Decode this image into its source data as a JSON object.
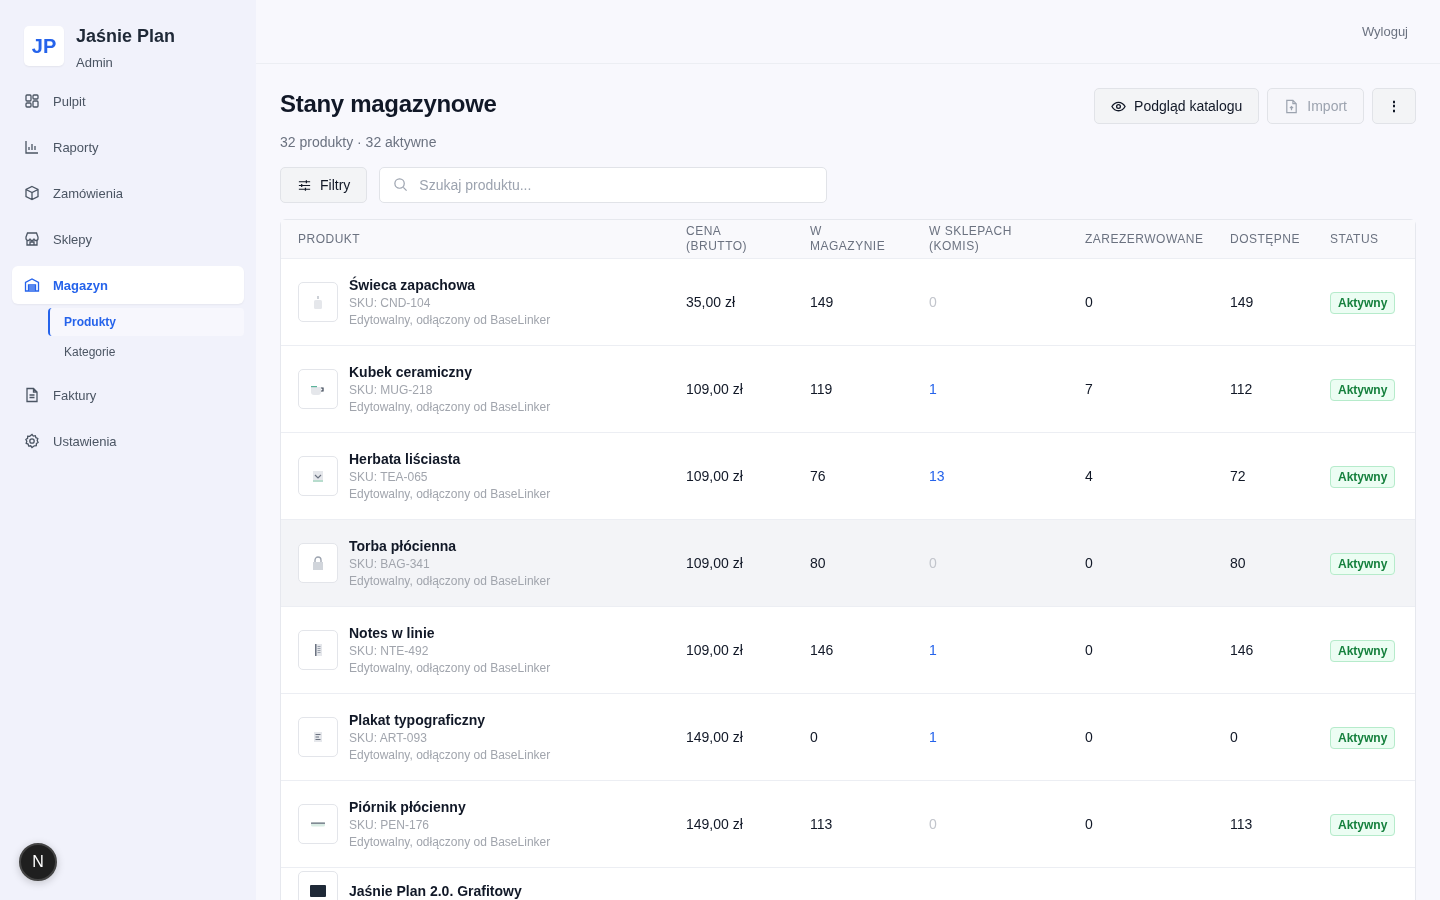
{
  "brand": {
    "initials": "JP",
    "name": "Jaśnie Plan",
    "role": "Admin"
  },
  "nav": [
    {
      "label": "Pulpit",
      "selected": false
    },
    {
      "label": "Raporty",
      "selected": false
    },
    {
      "label": "Zamówienia",
      "selected": false
    },
    {
      "label": "Sklepy",
      "selected": false
    },
    {
      "label": "Magazyn",
      "selected": true,
      "children": [
        {
          "label": "Produkty",
          "selected": true
        },
        {
          "label": "Kategorie",
          "selected": false
        }
      ]
    },
    {
      "label": "Faktury",
      "selected": false
    },
    {
      "label": "Ustawienia",
      "selected": false
    }
  ],
  "dev_badge": "N",
  "topbar": {
    "logout": "Wyloguj"
  },
  "page": {
    "title": "Stany magazynowe",
    "subtitle": "32 produkty · 32 aktywne"
  },
  "actions": [
    {
      "label": "Podgląd katalogu",
      "disabled": false
    },
    {
      "label": "Import",
      "disabled": true
    }
  ],
  "more_button": "⋮",
  "filters": {
    "label": "Filtry"
  },
  "search": {
    "placeholder": "Szukaj produktu..."
  },
  "table": {
    "columns": [
      "PRODUKT",
      "CENA (BRUTTO)",
      "W MAGAZYNIE",
      "W SKLEPACH (KOMIS)",
      "ZAREZERWOWANE",
      "DOSTĘPNE",
      "STATUS"
    ],
    "rows": [
      {
        "name": "Świeca zapachowa",
        "sku": "SKU: CND-104",
        "note": "Edytowalny, odłączony od BaseLinker",
        "price": "35,00 zł",
        "stock": "149",
        "stores": "0",
        "stores_link": false,
        "reserved": "0",
        "available": "149",
        "status": "Aktywny",
        "highlighted": false
      },
      {
        "name": "Kubek ceramiczny",
        "sku": "SKU: MUG-218",
        "note": "Edytowalny, odłączony od BaseLinker",
        "price": "109,00 zł",
        "stock": "119",
        "stores": "1",
        "stores_link": true,
        "reserved": "7",
        "available": "112",
        "status": "Aktywny",
        "highlighted": false
      },
      {
        "name": "Herbata liściasta",
        "sku": "SKU: TEA-065",
        "note": "Edytowalny, odłączony od BaseLinker",
        "price": "109,00 zł",
        "stock": "76",
        "stores": "13",
        "stores_link": true,
        "reserved": "4",
        "available": "72",
        "status": "Aktywny",
        "highlighted": false
      },
      {
        "name": "Torba płócienna",
        "sku": "SKU: BAG-341",
        "note": "Edytowalny, odłączony od BaseLinker",
        "price": "109,00 zł",
        "stock": "80",
        "stores": "0",
        "stores_link": false,
        "reserved": "0",
        "available": "80",
        "status": "Aktywny",
        "highlighted": true
      },
      {
        "name": "Notes w linie",
        "sku": "SKU: NTE-492",
        "note": "Edytowalny, odłączony od BaseLinker",
        "price": "109,00 zł",
        "stock": "146",
        "stores": "1",
        "stores_link": true,
        "reserved": "0",
        "available": "146",
        "status": "Aktywny",
        "highlighted": false
      },
      {
        "name": "Plakat typograficzny",
        "sku": "SKU: ART-093",
        "note": "Edytowalny, odłączony od BaseLinker",
        "price": "149,00 zł",
        "stock": "0",
        "stores": "1",
        "stores_link": true,
        "reserved": "0",
        "available": "0",
        "status": "Aktywny",
        "highlighted": false
      },
      {
        "name": "Piórnik płócienny",
        "sku": "SKU: PEN-176",
        "note": "Edytowalny, odłączony od BaseLinker",
        "price": "149,00 zł",
        "stock": "113",
        "stores": "0",
        "stores_link": false,
        "reserved": "0",
        "available": "113",
        "status": "Aktywny",
        "highlighted": false
      },
      {
        "name": "Jaśnie Plan 2.0. Grafitowy",
        "highlighted": false
      }
    ]
  }
}
